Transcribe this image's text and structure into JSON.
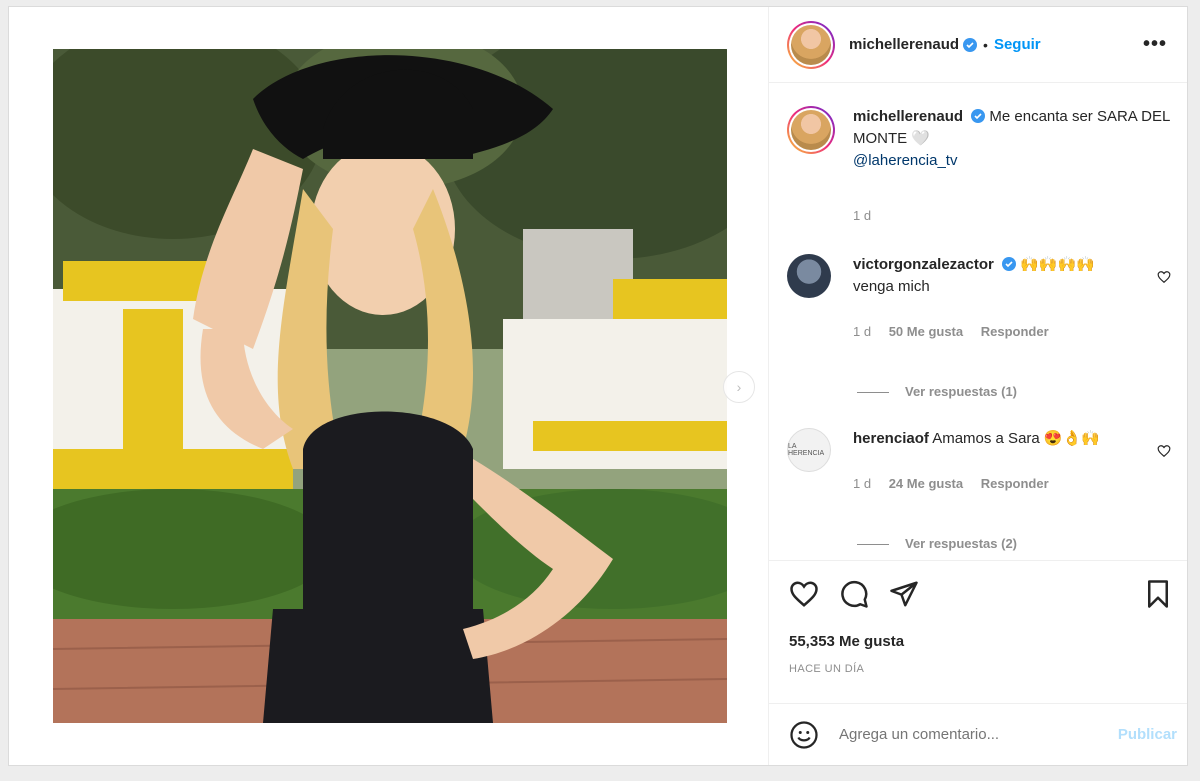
{
  "post": {
    "username": "michellerenaud",
    "follow_label": "Seguir",
    "more_label": "•••",
    "dot": "•"
  },
  "caption": {
    "username": "michellerenaud",
    "text": "Me encanta ser SARA DEL MONTE 🤍",
    "mention": "@laherencia_tv",
    "time": "1 d"
  },
  "comments": [
    {
      "username": "victorgonzalezactor",
      "text_line1": "🙌🙌🙌🙌",
      "text_line2": "venga mich",
      "time": "1 d",
      "likes": "50 Me gusta",
      "reply": "Responder",
      "view_replies": "Ver respuestas (1)"
    },
    {
      "username": "herenciaof",
      "text_line1": "Amamos a Sara 😍👌🙌",
      "time": "1 d",
      "likes": "24 Me gusta",
      "reply": "Responder",
      "view_replies": "Ver respuestas (2)"
    }
  ],
  "actions": {
    "likes_count": "55,353 Me gusta",
    "posted": "HACE UN DÍA"
  },
  "add_comment": {
    "placeholder": "Agrega un comentario...",
    "publish": "Publicar"
  },
  "colors": {
    "accent": "#0095f6",
    "muted": "#8e8e8e",
    "hat": "#111111",
    "dress": "#1b1b1f",
    "hair": "#e8c479",
    "wall_yellow": "#e7c520"
  },
  "icons": [
    "verified-badge-icon",
    "more-options-icon",
    "next-arrow-icon",
    "heart-icon",
    "comment-icon",
    "share-icon",
    "save-icon",
    "emoji-icon"
  ]
}
